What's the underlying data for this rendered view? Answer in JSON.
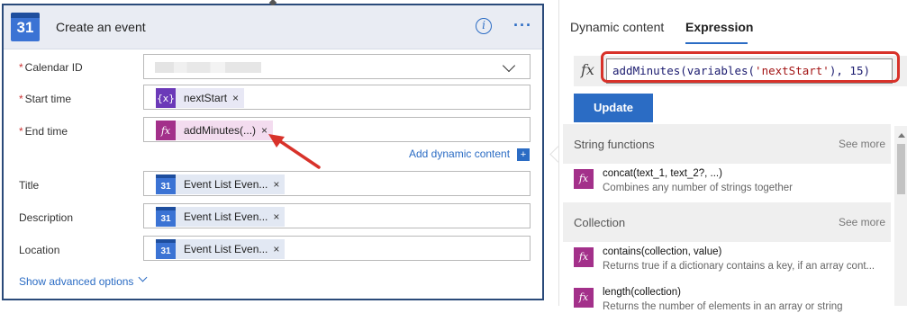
{
  "action_card": {
    "title": "Create an event",
    "calendar_icon_number": "31",
    "info_icon": "i",
    "more_icon": "···",
    "fields": {
      "calendar_id": {
        "label": "Calendar ID",
        "required": "*"
      },
      "start_time": {
        "label": "Start time",
        "required": "*",
        "token": "nextStart",
        "token_icon": "{x}"
      },
      "end_time": {
        "label": "End time",
        "required": "*",
        "token": "addMinutes(...)",
        "token_icon": "fx"
      },
      "title": {
        "label": "Title",
        "token": "Event List Even..."
      },
      "description": {
        "label": "Description",
        "token": "Event List Even..."
      },
      "location": {
        "label": "Location",
        "token": "Event List Even..."
      }
    },
    "token_remove": "×",
    "add_dynamic_content": "Add dynamic content",
    "add_dynamic_plus": "+",
    "show_advanced_options": "Show advanced options"
  },
  "panel": {
    "tabs": [
      "Dynamic content",
      "Expression"
    ],
    "active_tab": "Expression",
    "expression": {
      "fx_label": "fx",
      "parts": [
        "addMinutes(variables(",
        "'nextStart'",
        "), 15)"
      ]
    },
    "update_button": "Update",
    "sections": [
      {
        "title": "String functions",
        "see_more": "See more",
        "functions": [
          {
            "name": "concat(text_1, text_2?, ...)",
            "desc": "Combines any number of strings together"
          }
        ]
      },
      {
        "title": "Collection",
        "see_more": "See more",
        "functions": [
          {
            "name": "contains(collection, value)",
            "desc": "Returns true if a dictionary contains a key, if an array cont..."
          },
          {
            "name": "length(collection)",
            "desc": "Returns the number of elements in an array or string"
          }
        ]
      }
    ]
  },
  "colors": {
    "accent": "#2b6cc4",
    "highlight_red": "#d8322a",
    "fx_magenta": "#a3308a",
    "variable_purple": "#6b39b8"
  }
}
